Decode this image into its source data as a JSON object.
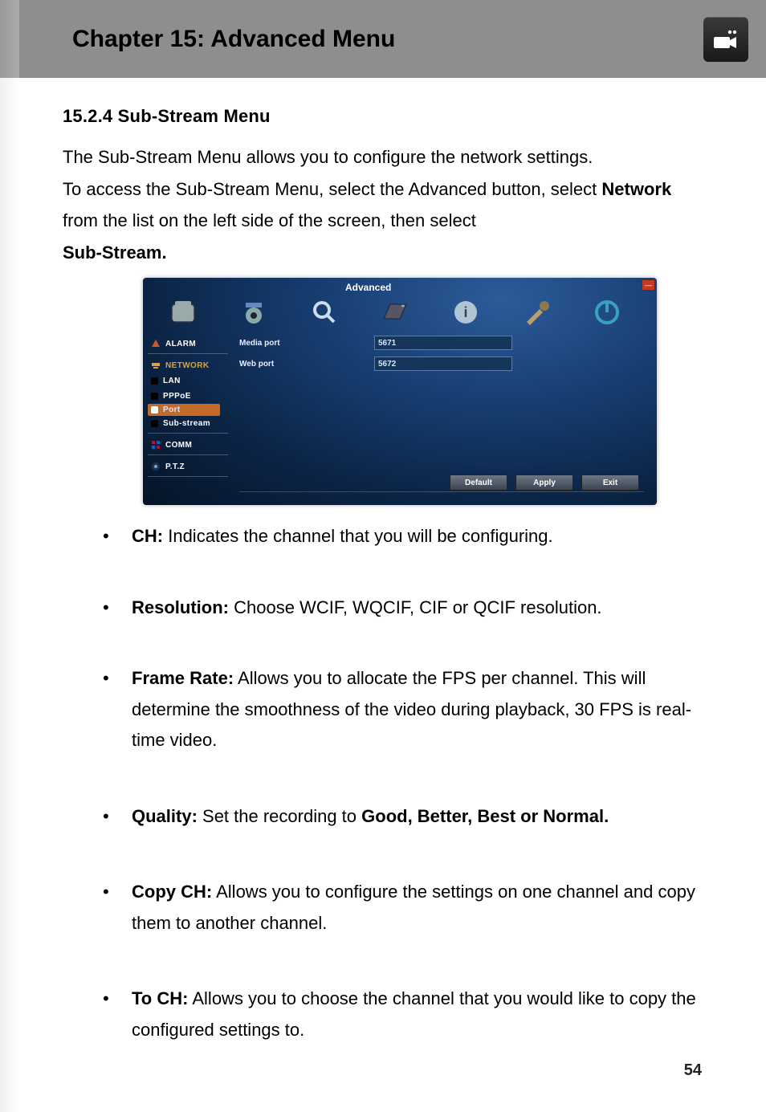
{
  "header": {
    "title": "Chapter 15: Advanced Menu"
  },
  "section": {
    "heading": "15.2.4 Sub-Stream Menu"
  },
  "intro": {
    "p1": "The Sub-Stream Menu allows you to configure the network settings.",
    "p2a": "To access the Sub-Stream Menu, select the Advanced button, select ",
    "p2b": "Network",
    "p2c": " from the list on the left side of the screen, then select ",
    "p2d": "Sub-Stream."
  },
  "dvr": {
    "window_title": "Advanced",
    "close": "—",
    "sidebar": {
      "alarm": "ALARM",
      "network": "NETWORK",
      "lan": "LAN",
      "pppoe": "PPPoE",
      "port": "Port",
      "substream": "Sub-stream",
      "comm": "COMM",
      "ptz": "P.T.Z"
    },
    "fields": {
      "media_port_label": "Media port",
      "media_port_value": "5671",
      "web_port_label": "Web port",
      "web_port_value": "5672"
    },
    "buttons": {
      "default": "Default",
      "apply": "Apply",
      "exit": "Exit"
    }
  },
  "bullets": {
    "ch_label": "CH:",
    "ch_text": " Indicates the channel that you will be configuring.",
    "res_label": "Resolution:",
    "res_text": " Choose WCIF, WQCIF, CIF or QCIF resolution.",
    "fr_label": "Frame Rate:",
    "fr_text": " Allows you to allocate the FPS per channel. This will determine the smoothness of the video during playback, 30 FPS is real-time video.",
    "q_label": "Quality:",
    "q_text_a": " Set the recording to ",
    "q_text_b": "Good, Better, Best or Normal.",
    "copy_label": "Copy CH:",
    "copy_text": " Allows you to configure the settings on one channel and copy them to another channel.",
    "to_label": "To CH:",
    "to_text": " Allows you to choose the channel that you would like to copy the configured settings to."
  },
  "page_number": "54"
}
